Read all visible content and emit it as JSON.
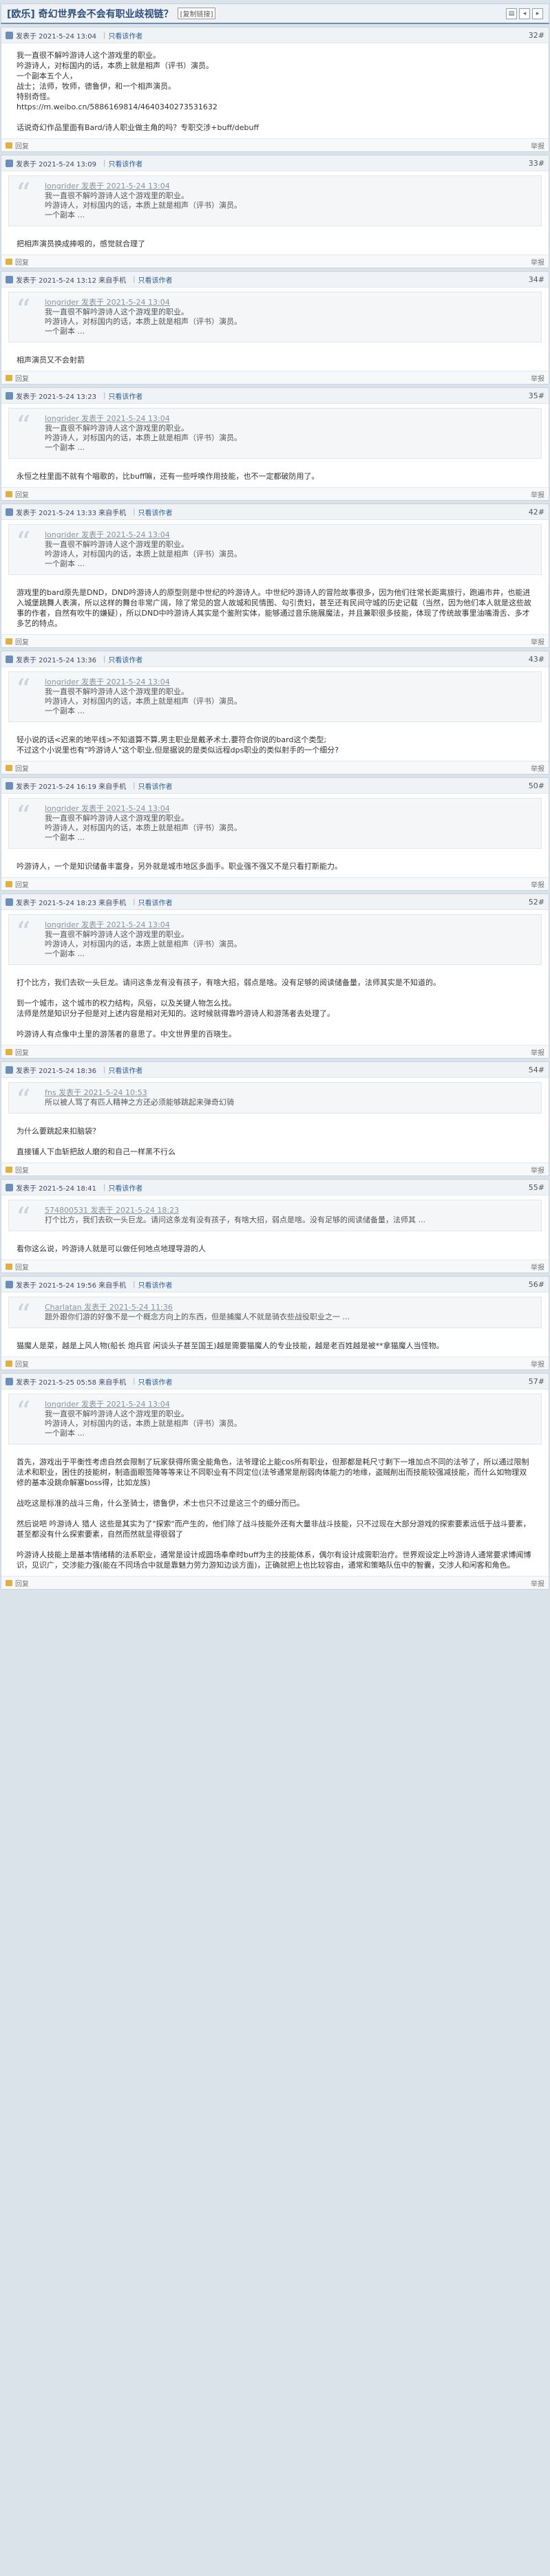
{
  "header": {
    "title": "[欧乐] 奇幻世界会不会有职业歧视链？",
    "tag": "[复制链接]"
  },
  "ui": {
    "report": "举报",
    "reply": "回复",
    "dots": "...",
    "quote_glyph": "“"
  },
  "posts": [
    {
      "author": "发表于 2021-5-24 13:04",
      "only": "只看该作者",
      "floor": "32#",
      "quote": null,
      "lines": [
        "我一直很不解吟游诗人这个游戏里的职业。",
        "吟游诗人，对标国内的话，本质上就是相声（评书）演员。",
        "一个副本五个人，",
        "战士；法师，牧师，德鲁伊，和一个相声演员。",
        "特别奇怪。",
        "https://m.weibo.cn/5886169814/4640340273531632",
        "",
        "话说奇幻作品里面有Bard/诗人职业做主角的吗？专职交涉+buff/debuff"
      ],
      "footer_left": "回复"
    },
    {
      "author": "发表于 2021-5-24 13:09",
      "only": "只看该作者",
      "floor": "33#",
      "quote": {
        "head": "longrider 发表于 2021-5-24 13:04",
        "lines": [
          "我一直很不解吟游诗人这个游戏里的职业。",
          "吟游诗人，对标国内的话，本质上就是相声（评书）演员。",
          "一个副本 ..."
        ]
      },
      "lines": [
        "把相声演员换成捧哏的，感觉就合理了"
      ],
      "footer_left": "回复"
    },
    {
      "author": "发表于 2021-5-24 13:12 来自手机",
      "only": "只看该作者",
      "floor": "34#",
      "quote": {
        "head": "longrider 发表于 2021-5-24 13:04",
        "lines": [
          "我一直很不解吟游诗人这个游戏里的职业。",
          "吟游诗人，对标国内的话，本质上就是相声（评书）演员。",
          "一个副本 ..."
        ]
      },
      "lines": [
        "相声演员又不会射箭"
      ],
      "footer_left": "回复"
    },
    {
      "author": "发表于 2021-5-24 13:23",
      "only": "只看该作者",
      "floor": "35#",
      "quote": {
        "head": "longrider 发表于 2021-5-24 13:04",
        "lines": [
          "我一直很不解吟游诗人这个游戏里的职业。",
          "吟游诗人，对标国内的话，本质上就是相声（评书）演员。",
          "一个副本 ..."
        ]
      },
      "lines": [
        "永恒之柱里面不就有个唱歌的，比buff嘛，还有一些呼唤作用技能，也不一定都破防用了。"
      ],
      "footer_left": "回复"
    },
    {
      "author": "发表于 2021-5-24 13:33 来自手机",
      "only": "只看该作者",
      "floor": "42#",
      "quote": {
        "head": "longrider 发表于 2021-5-24 13:04",
        "lines": [
          "我一直很不解吟游诗人这个游戏里的职业。",
          "吟游诗人，对标国内的话，本质上就是相声（评书）演员。",
          "一个副本 ..."
        ]
      },
      "lines": [
        "游戏里的bard原先是DND，DND吟游诗人的原型则是中世纪的吟游诗人。中世纪吟游诗人的冒险故事很多，因为他们往常长距离旅行，跑遍市井，也能进入城堡跳舞人表演，所以这样的舞台非常广阔，除了常见的宫人故城和民情图、勾引贵妇，甚至还有民间守城的历史记载（当然，因为他们本人就是这些故事的作者，自然有吹牛的嫌疑），所以DND中吟游诗人其实是个鉴附实体，能够通过音乐施展魔法，并且兼职很多技能，体现了传统故事里油嘴滑舌、多才多艺的特点。"
      ],
      "footer_left": "回复"
    },
    {
      "author": "发表于 2021-5-24 13:36",
      "only": "只看该作者",
      "floor": "43#",
      "quote": {
        "head": "longrider 发表于 2021-5-24 13:04",
        "lines": [
          "我一直很不解吟游诗人这个游戏里的职业。",
          "吟游诗人，对标国内的话，本质上就是相声（评书）演员。",
          "一个副本 ..."
        ]
      },
      "lines": [
        "轻小说的话<迟来的地平线>不知道算不算,男主职业是戴矛术士,要符合你说的bard这个类型;",
        "不过这个小说里也有\"吟游诗人\"这个职业,但是据说的是类似远程dps职业的类似射手的一个细分?"
      ],
      "footer_left": "回复"
    },
    {
      "author": "发表于 2021-5-24 16:19 来自手机",
      "only": "只看该作者",
      "floor": "50#",
      "quote": {
        "head": "longrider 发表于 2021-5-24 13:04",
        "lines": [
          "我一直很不解吟游诗人这个游戏里的职业。",
          "吟游诗人，对标国内的话，本质上就是相声（评书）演员。",
          "一个副本 ..."
        ]
      },
      "lines": [
        "吟游诗人，一个是知识储备丰富身，另外就是城市地区多面手。职业强不强又不是只看打斯能力。"
      ],
      "footer_left": "回复"
    },
    {
      "author": "发表于 2021-5-24 18:23 来自手机",
      "only": "只看该作者",
      "floor": "52#",
      "quote": {
        "head": "longrider 发表于 2021-5-24 13:04",
        "lines": [
          "我一直很不解吟游诗人这个游戏里的职业。",
          "吟游诗人，对标国内的话，本质上就是相声（评书）演员。",
          "一个副本 ..."
        ]
      },
      "lines": [
        "打个比方，我们去砍一头巨龙。请问这条龙有没有孩子，有啥大招，弱点是啥。没有足够的阅读储备量，法师其实是不知道的。",
        "",
        "到一个城市，这个城市的权力结构，风俗，以及关键人物怎么找。",
        "法师是然是知识分子但是对上述内容是相对无知的。这时候就得靠吟游诗人和游荡者去处理了。",
        "",
        "吟游诗人有点像中土里的游荡者的意思了。中文世界里的百晓生。"
      ],
      "footer_left": "回复"
    },
    {
      "author": "发表于 2021-5-24 18:36",
      "only": "只看该作者",
      "floor": "54#",
      "quote": {
        "head": "fns 发表于 2021-5-24 10:53",
        "lines": [
          "所以被人骂了有匹人精神之方还必须能够跳起来弹奇幻骑"
        ]
      },
      "lines": [
        "为什么要跳起来扣脑袋？",
        "",
        "直接铺人下血斩把敌人磨的和自己一样黑不行么"
      ],
      "footer_left": "回复"
    },
    {
      "author": "发表于 2021-5-24 18:41",
      "only": "只看该作者",
      "floor": "55#",
      "quote": {
        "head": "574800531 发表于 2021-5-24 18:23",
        "lines": [
          "打个比方，我们去砍一头巨龙。请问这条龙有没有孩子，有啥大招，弱点是啥。没有足够的阅读储备量，法师其 ..."
        ]
      },
      "lines": [
        "看你这么说，吟游诗人就是可以做任何地点地理导游的人"
      ],
      "footer_left": "回复"
    },
    {
      "author": "发表于 2021-5-24 19:56 来自手机",
      "only": "只看该作者",
      "floor": "56#",
      "quote": {
        "head": "Charlatan 发表于 2021-5-24 11:36",
        "lines": [
          "题外跟你们游的好像不是一个概念方向上的东西，但是捕魔人不就是骑衣些战役职业之一 ..."
        ]
      },
      "lines": [
        "猫魔人是菜，越是上风人物(船长 炮兵官 闲谈头子甚至国王)越是需要猫魔人的专业技能，越是老百姓越是被**拿猫魔人当怪物。"
      ],
      "footer_left": "回复"
    },
    {
      "author": "发表于 2021-5-25 05:58 来自手机",
      "only": "只看该作者",
      "floor": "57#",
      "quote": {
        "head": "longrider 发表于 2021-5-24 13:04",
        "lines": [
          "我一直很不解吟游诗人这个游戏里的职业。",
          "吟游诗人，对标国内的话，本质上就是相声（评书）演员。",
          "一个副本 ..."
        ]
      },
      "lines": [
        "首先，游戏出于平衡性考虑自然会限制了玩家获得所需全能角色，法爷理论上能cos所有职业，但那都是耗尺寸剩下一堆加点不同的法爷了，所以通过限制法术和职业，困住的技能树，制造面眼签降等等来让不同职业有不同定位(法爷通常是削弱肉体能力的地缘，盗贼削出而技能较强减技能，而什么如物理双修的基本没跳命解塞boss得，比如龙族)",
        "",
        "战吃这是标准的战斗三角，什么圣骑士，德鲁伊，术士也只不过是这三个的细分而已。",
        "",
        "然后说吧 吟游诗人 猎人 这些是其实为了\"探索\"而产生的，他们除了战斗技能外还有大量非战斗技能，只不过现在大部分游戏的探索要素远低于战斗要素，甚至都没有什么探索要素，自然而然就显得很弱了",
        "",
        "吟游诗人技能上是基本情绪精的法系职业，通常是设计成圆场奉牵时buff为主的技能体系，偶尔有设计成需职治疗。世界观设定上吟游诗人通常要求博闻博识，见识广，交涉能力强(能在不同场合中就是靠魅力劳力游知边谈方面)，正确就把上也比较容由，通常和策略队伍中的智囊，交涉人和闲客和角色。"
      ],
      "footer_left": "回复"
    }
  ]
}
